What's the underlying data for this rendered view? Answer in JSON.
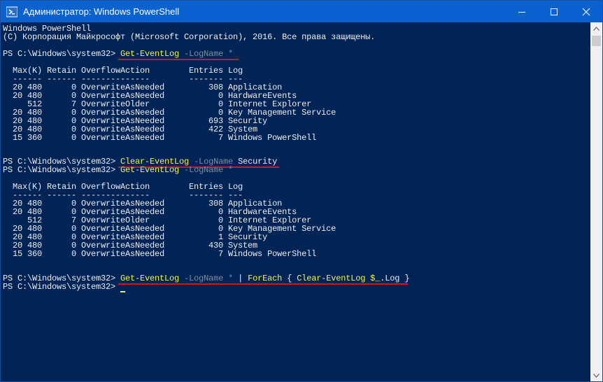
{
  "window": {
    "title": "Администратор: Windows PowerShell",
    "icons": {
      "app": "powershell-icon",
      "minimize": "minimize-icon",
      "maximize": "maximize-icon",
      "close": "close-icon"
    },
    "colors": {
      "titlebar": "#0a62d0",
      "console_bg": "#012456",
      "console_text": "#eeedf0",
      "command": "#f5f542",
      "parameter": "#7f8c9a",
      "underline": "#e01010"
    }
  },
  "console": {
    "banner_1": "Windows PowerShell",
    "banner_2": "(C) Корпорация Майкрософт (Microsoft Corporation), 2016. Все права защищены.",
    "prompt": "PS C:\\Windows\\system32> ",
    "cmd1": {
      "cmdlet": "Get-EventLog",
      "param": "-LogName",
      "arg": "*"
    },
    "table_header": "  Max(K) Retain OverflowAction        Entries Log",
    "table_sep": "  ------ ------ --------------        ------- ---",
    "table1": [
      "  20 480      0 OverwriteAsNeeded         308 Application",
      "  20 480      0 OverwriteAsNeeded           0 HardwareEvents",
      "     512      7 OverwriteOlder              0 Internet Explorer",
      "  20 480      0 OverwriteAsNeeded           0 Key Management Service",
      "  20 480      0 OverwriteAsNeeded         693 Security",
      "  20 480      0 OverwriteAsNeeded         422 System",
      "  15 360      0 OverwriteAsNeeded           7 Windows PowerShell"
    ],
    "cmd2": {
      "cmdlet": "Clear-EventLog",
      "param": "-LogName",
      "arg": "Security"
    },
    "cmd3": {
      "cmdlet": "Get-EventLog",
      "param": "-LogName",
      "arg": "*"
    },
    "table2": [
      "  20 480      0 OverwriteAsNeeded         308 Application",
      "  20 480      0 OverwriteAsNeeded           0 HardwareEvents",
      "     512      7 OverwriteOlder              0 Internet Explorer",
      "  20 480      0 OverwriteAsNeeded           0 Key Management Service",
      "  20 480      0 OverwriteAsNeeded           1 Security",
      "  20 480      0 OverwriteAsNeeded         430 System",
      "  15 360      0 OverwriteAsNeeded           7 Windows PowerShell"
    ],
    "cmd4": {
      "cmdlet": "Get-EventLog",
      "param": "-LogName",
      "arg": "*",
      "pipe": "|",
      "foreach": "ForEach",
      "brace_open": "{",
      "inner_cmdlet": "Clear-EventLog",
      "var": "$_",
      "prop": ".Log",
      "brace_close": "}"
    }
  }
}
